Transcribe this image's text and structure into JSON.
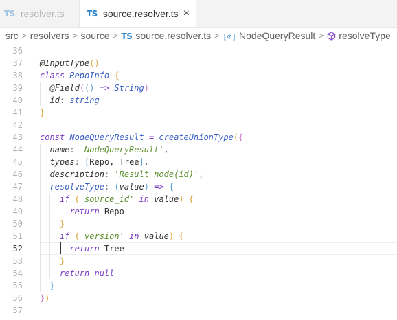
{
  "tabs": [
    {
      "glyph": "TS",
      "label": "resolver.ts",
      "active": false
    },
    {
      "glyph": "TS",
      "label": "source.resolver.ts",
      "active": true,
      "close": "×"
    }
  ],
  "breadcrumb": {
    "items": [
      "src",
      "resolvers",
      "source"
    ],
    "file": {
      "glyph": "TS",
      "label": "source.resolver.ts"
    },
    "symbol": {
      "glyph": "[⊙]",
      "label": "NodeQueryResult"
    },
    "member": {
      "label": "resolveType"
    },
    "separator": ">"
  },
  "editor": {
    "current_line": 52,
    "lines": [
      {
        "num": "36",
        "tokens": []
      },
      {
        "num": "37",
        "tokens": [
          [
            "deco",
            "@InputType"
          ],
          [
            "br1",
            "()"
          ]
        ]
      },
      {
        "num": "38",
        "tokens": [
          [
            "kw",
            "class "
          ],
          [
            "cls",
            "RepoInfo "
          ],
          [
            "br1",
            "{"
          ]
        ]
      },
      {
        "num": "39",
        "tokens": [
          [
            "plain",
            "  "
          ],
          [
            "deco",
            "@Field"
          ],
          [
            "br2",
            "("
          ],
          [
            "br3",
            "()"
          ],
          [
            "op",
            " => "
          ],
          [
            "typ",
            "String"
          ],
          [
            "br2",
            ")"
          ]
        ]
      },
      {
        "num": "40",
        "tokens": [
          [
            "plain",
            "  "
          ],
          [
            "prop",
            "id"
          ],
          [
            "pun",
            ": "
          ],
          [
            "typ",
            "string"
          ]
        ]
      },
      {
        "num": "41",
        "tokens": [
          [
            "br1",
            "}"
          ]
        ]
      },
      {
        "num": "42",
        "tokens": []
      },
      {
        "num": "43",
        "tokens": [
          [
            "kw",
            "const "
          ],
          [
            "cls",
            "NodeQueryResult"
          ],
          [
            "op",
            " = "
          ],
          [
            "fn",
            "createUnionType"
          ],
          [
            "br1",
            "("
          ],
          [
            "br2",
            "{"
          ]
        ]
      },
      {
        "num": "44",
        "tokens": [
          [
            "plain",
            "  "
          ],
          [
            "prop",
            "name"
          ],
          [
            "pun",
            ": "
          ],
          [
            "str",
            "'NodeQueryResult'"
          ],
          [
            "pun",
            ","
          ]
        ]
      },
      {
        "num": "45",
        "tokens": [
          [
            "plain",
            "  "
          ],
          [
            "prop",
            "types"
          ],
          [
            "pun",
            ": "
          ],
          [
            "br3",
            "["
          ],
          [
            "plain",
            "Repo, Tree"
          ],
          [
            "br3",
            "]"
          ],
          [
            "pun",
            ","
          ]
        ]
      },
      {
        "num": "46",
        "tokens": [
          [
            "plain",
            "  "
          ],
          [
            "prop",
            "description"
          ],
          [
            "pun",
            ": "
          ],
          [
            "str",
            "'Result node(id)'"
          ],
          [
            "pun",
            ","
          ]
        ]
      },
      {
        "num": "47",
        "tokens": [
          [
            "plain",
            "  "
          ],
          [
            "fn",
            "resolveType"
          ],
          [
            "pun",
            ": "
          ],
          [
            "br3",
            "("
          ],
          [
            "var",
            "value"
          ],
          [
            "br3",
            ")"
          ],
          [
            "op",
            " => "
          ],
          [
            "br3",
            "{"
          ]
        ]
      },
      {
        "num": "48",
        "tokens": [
          [
            "plain",
            "    "
          ],
          [
            "kw",
            "if "
          ],
          [
            "br1",
            "("
          ],
          [
            "str",
            "'source_id'"
          ],
          [
            "kw",
            " in "
          ],
          [
            "var",
            "value"
          ],
          [
            "br1",
            ")"
          ],
          [
            "br1",
            " {"
          ]
        ]
      },
      {
        "num": "49",
        "tokens": [
          [
            "plain",
            "      "
          ],
          [
            "kw",
            "return "
          ],
          [
            "plain",
            "Repo"
          ]
        ]
      },
      {
        "num": "50",
        "tokens": [
          [
            "plain",
            "    "
          ],
          [
            "br1",
            "}"
          ]
        ]
      },
      {
        "num": "51",
        "tokens": [
          [
            "plain",
            "    "
          ],
          [
            "kw",
            "if "
          ],
          [
            "br1",
            "("
          ],
          [
            "str",
            "'version'"
          ],
          [
            "kw",
            " in "
          ],
          [
            "var",
            "value"
          ],
          [
            "br1",
            ")"
          ],
          [
            "br1",
            " {"
          ]
        ]
      },
      {
        "num": "52",
        "tokens": [
          [
            "plain",
            "      "
          ],
          [
            "kw",
            "return "
          ],
          [
            "plain",
            "Tree"
          ]
        ]
      },
      {
        "num": "53",
        "tokens": [
          [
            "plain",
            "    "
          ],
          [
            "br1",
            "}"
          ]
        ]
      },
      {
        "num": "54",
        "tokens": [
          [
            "plain",
            "    "
          ],
          [
            "kw",
            "return "
          ],
          [
            "kw",
            "null"
          ]
        ]
      },
      {
        "num": "55",
        "tokens": [
          [
            "plain",
            "  "
          ],
          [
            "br3",
            "}"
          ]
        ]
      },
      {
        "num": "56",
        "tokens": [
          [
            "br2",
            "}"
          ],
          [
            "br1",
            ")"
          ]
        ]
      },
      {
        "num": "57",
        "tokens": []
      }
    ]
  },
  "colors": {
    "accent": "#2f86c9",
    "keyword": "#7b3fc4",
    "string": "#5e8f2f"
  }
}
